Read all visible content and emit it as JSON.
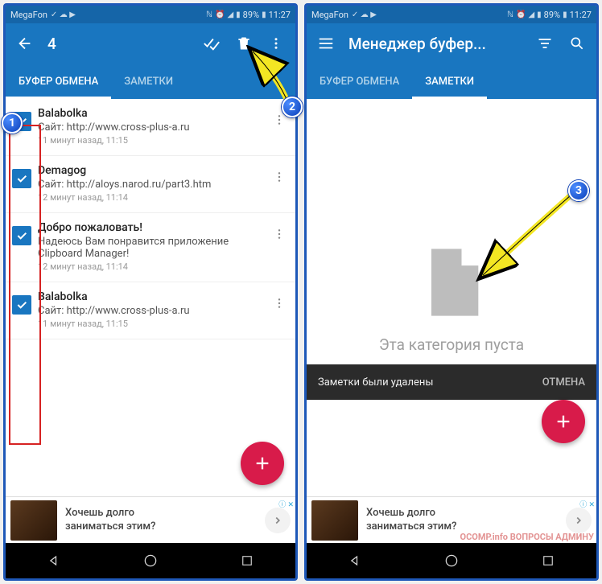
{
  "status": {
    "carrier": "MegaFon",
    "battery": "89%",
    "time": "11:27"
  },
  "left": {
    "selectedCount": "4",
    "tabs": {
      "clipboard": "БУФЕР ОБМЕНА",
      "notes": "ЗАМЕТКИ"
    },
    "items": [
      {
        "title": "Balabolka",
        "sub": "Сайт: http://www.cross-plus-a.ru",
        "time": "11 минут назад, 11:15"
      },
      {
        "title": "Demagog",
        "sub": "Сайт: http://aloys.narod.ru/part3.htm",
        "time": "12 минут назад, 11:14"
      },
      {
        "title": "Добро пожаловать!",
        "sub": "Надеюсь Вам понравится приложение Clipboard Manager!",
        "time": "12 минут назад, 11:14"
      },
      {
        "title": "Balabolka",
        "sub": "Сайт: http://www.cross-plus-a.ru",
        "time": "11 минут назад, 11:15"
      }
    ]
  },
  "right": {
    "title": "Менеджер буфер...",
    "tabs": {
      "clipboard": "БУФЕР ОБМЕНА",
      "notes": "ЗАМЕТКИ"
    },
    "empty": "Эта категория пуста",
    "snackbar": {
      "text": "Заметки были удалены",
      "action": "ОТМЕНА"
    }
  },
  "ad": {
    "line1": "Хочешь долго",
    "line2": "заниматься этим?"
  },
  "callouts": {
    "c1": "1",
    "c2": "2",
    "c3": "3"
  },
  "watermark": "OCOMP.info\nВОПРОСЫ АДМИНУ"
}
